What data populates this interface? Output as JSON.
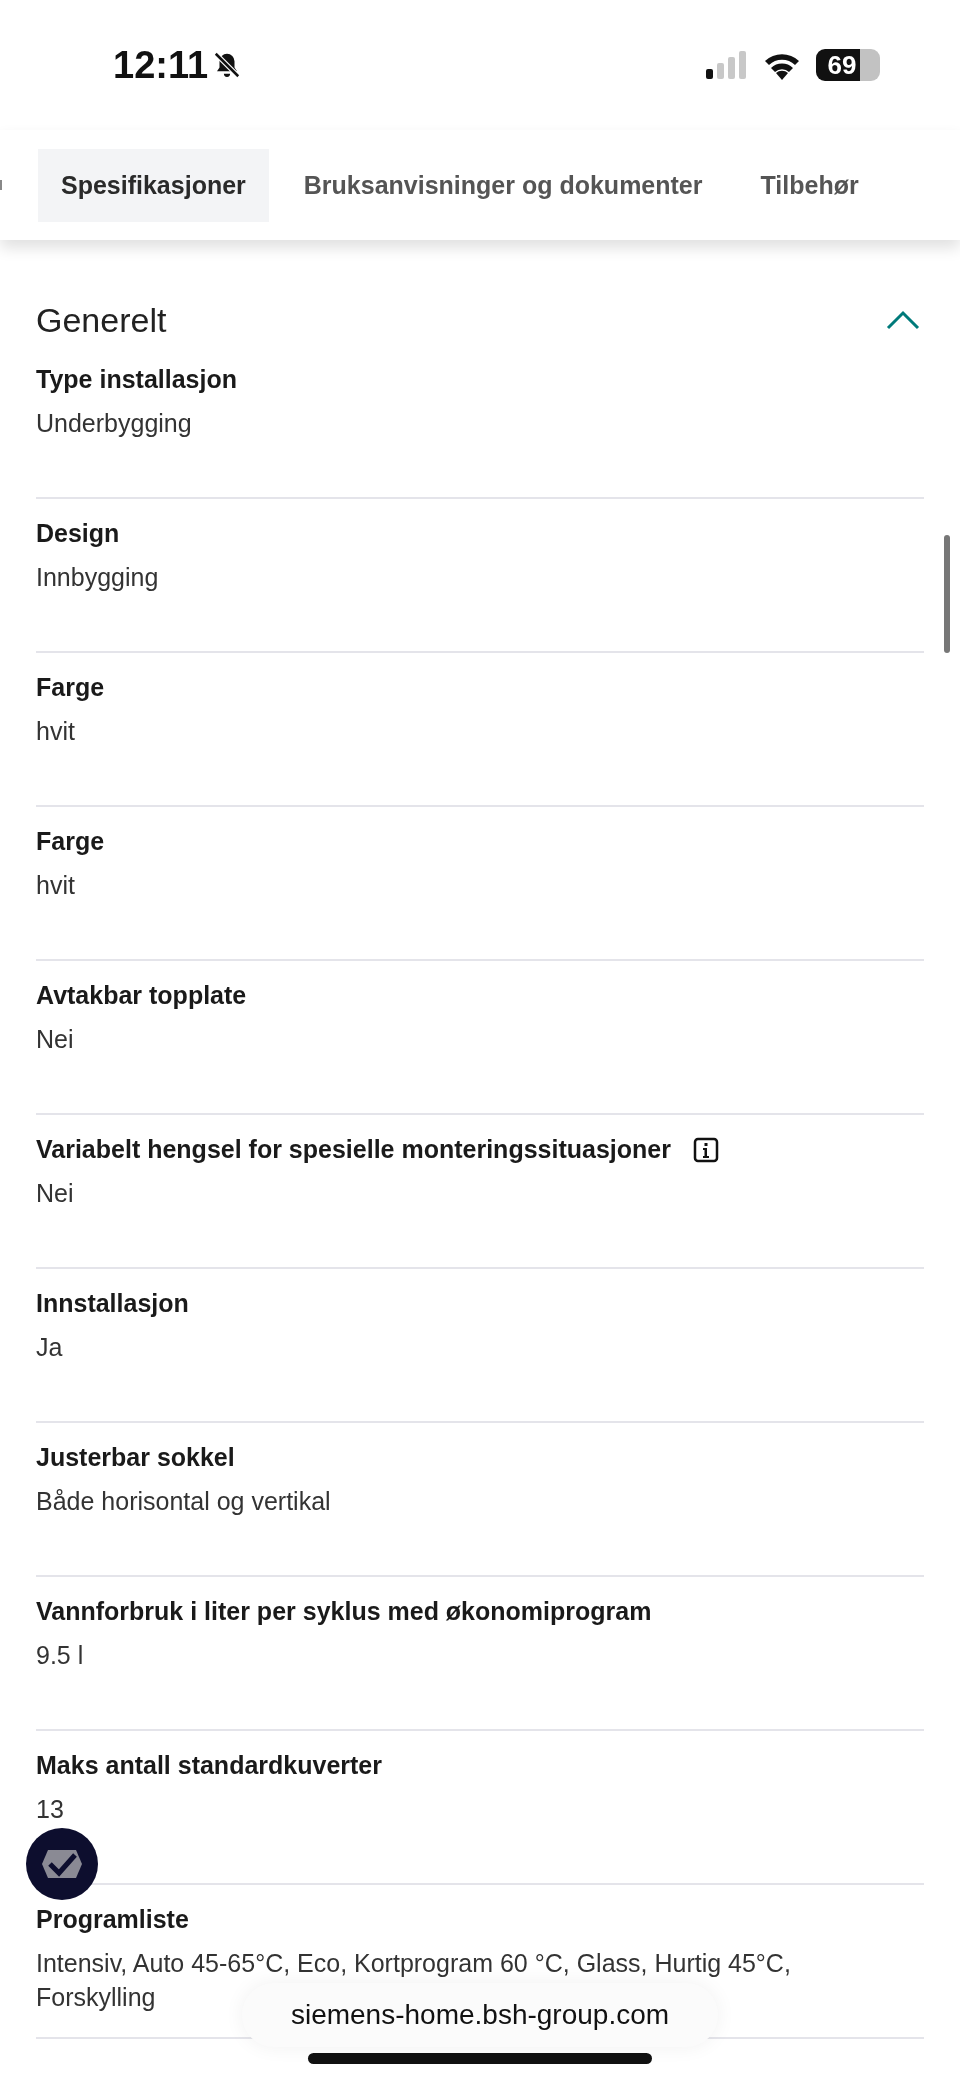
{
  "status_bar": {
    "time": "12:11",
    "battery": "69"
  },
  "tabs": [
    {
      "label": "Spesifikasjoner",
      "selected": true
    },
    {
      "label": "Bruksanvisninger og dokumenter",
      "selected": false
    },
    {
      "label": "Tilbehør",
      "selected": false
    }
  ],
  "section": {
    "title": "Generelt",
    "expanded": true
  },
  "specs": [
    {
      "label": "Type installasjon",
      "value": "Underbygging",
      "info": false
    },
    {
      "label": "Design",
      "value": "Innbygging",
      "info": false
    },
    {
      "label": "Farge",
      "value": "hvit",
      "info": false
    },
    {
      "label": "Farge",
      "value": "hvit",
      "info": false
    },
    {
      "label": "Avtakbar topplate",
      "value": "Nei",
      "info": false
    },
    {
      "label": "Variabelt hengsel for spesielle monteringssituasjoner",
      "value": "Nei",
      "info": true
    },
    {
      "label": "Innstallasjon",
      "value": "Ja",
      "info": false
    },
    {
      "label": "Justerbar sokkel",
      "value": "Både horisontal og vertikal",
      "info": false
    },
    {
      "label": "Vannforbruk i liter per syklus med økonomiprogram",
      "value": "9.5 l",
      "info": false
    },
    {
      "label": "Maks antall standardkuverter",
      "value": "13",
      "info": false
    },
    {
      "label": "Programliste",
      "value": "Intensiv, Auto 45-65°C, Eco, Kortprogram 60 °C, Glass, Hurtig 45°C, Forskylling",
      "info": false
    }
  ],
  "url_bar": {
    "url": "siemens-home.bsh-group.com"
  }
}
